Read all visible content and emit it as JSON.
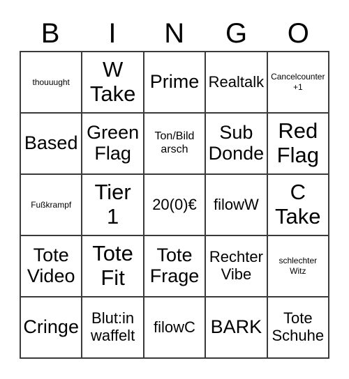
{
  "card": {
    "title_letters": [
      "B",
      "I",
      "N",
      "G",
      "O"
    ],
    "columns": 5,
    "rows": 5,
    "border_color": "#3a3a3a",
    "background_color": "#ffffff",
    "text_color": "#000000"
  },
  "cells": [
    {
      "text": "thouuught",
      "size": "xs"
    },
    {
      "text": "W\nTake",
      "size": "xl"
    },
    {
      "text": "Prime",
      "size": "lg"
    },
    {
      "text": "Realtalk",
      "size": "md"
    },
    {
      "text": "Cancelcounter\n+1",
      "size": "xs"
    },
    {
      "text": "Based",
      "size": "lg"
    },
    {
      "text": "Green\nFlag",
      "size": "lg"
    },
    {
      "text": "Ton/Bild\narsch",
      "size": "sm"
    },
    {
      "text": "Sub\nDonde",
      "size": "lg"
    },
    {
      "text": "Red\nFlag",
      "size": "xl"
    },
    {
      "text": "Fußkrampf",
      "size": "xs"
    },
    {
      "text": "Tier\n1",
      "size": "xl"
    },
    {
      "text": "20(0)€",
      "size": "md"
    },
    {
      "text": "filowW",
      "size": "md"
    },
    {
      "text": "C\nTake",
      "size": "xl"
    },
    {
      "text": "Tote\nVideo",
      "size": "lg"
    },
    {
      "text": "Tote\nFit",
      "size": "xl"
    },
    {
      "text": "Tote\nFrage",
      "size": "lg"
    },
    {
      "text": "Rechter\nVibe",
      "size": "md"
    },
    {
      "text": "schlechter\nWitz",
      "size": "xs"
    },
    {
      "text": "Cringe",
      "size": "lg"
    },
    {
      "text": "Blut:in\nwaffelt",
      "size": "md"
    },
    {
      "text": "filowC",
      "size": "md"
    },
    {
      "text": "BARK",
      "size": "lg"
    },
    {
      "text": "Tote\nSchuhe",
      "size": "md"
    }
  ]
}
